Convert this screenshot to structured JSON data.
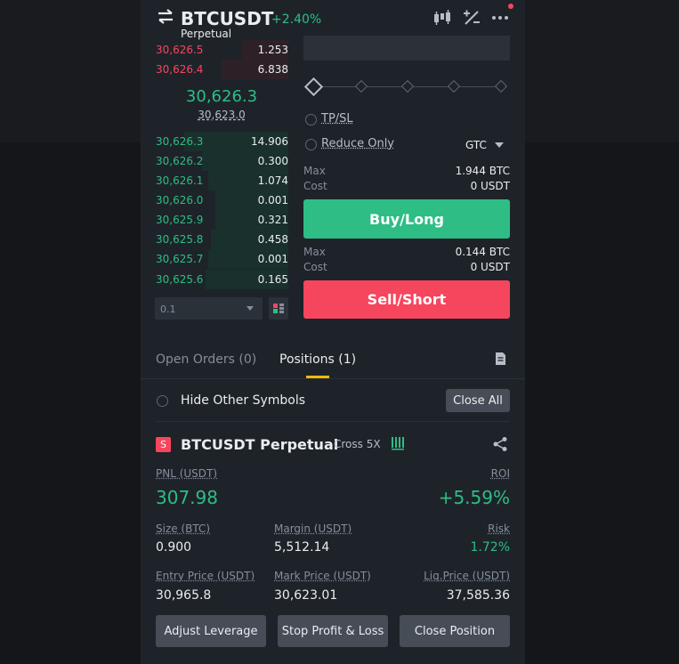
{
  "header": {
    "symbol": "BTCUSDT",
    "change": "+2.40%",
    "contract_type": "Perpetual",
    "icons": [
      "swap-icon",
      "candlestick-chart-icon",
      "percent-icon",
      "more-icon"
    ]
  },
  "order_book": {
    "asks": [
      {
        "price": "30,626.5",
        "qty": "1.253",
        "depth": 0.35
      },
      {
        "price": "30,626.4",
        "qty": "6.838",
        "depth": 0.5
      }
    ],
    "last_price": "30,626.3",
    "mark_price": "30,623.0",
    "bids": [
      {
        "price": "30,626.3",
        "qty": "14.906",
        "depth": 0.78
      },
      {
        "price": "30,626.2",
        "qty": "0.300",
        "depth": 0.65
      },
      {
        "price": "30,626.1",
        "qty": "1.074",
        "depth": 0.6
      },
      {
        "price": "30,626.0",
        "qty": "0.001",
        "depth": 0.55
      },
      {
        "price": "30,625.9",
        "qty": "0.321",
        "depth": 0.55
      },
      {
        "price": "30,625.8",
        "qty": "0.458",
        "depth": 0.58
      },
      {
        "price": "30,625.7",
        "qty": "0.001",
        "depth": 0.6
      },
      {
        "price": "30,625.6",
        "qty": "0.165",
        "depth": 0.62
      }
    ],
    "depth_precision": "0.1"
  },
  "order_form": {
    "tp_sl_label": "TP/SL",
    "reduce_only_label": "Reduce Only",
    "time_in_force": "GTC",
    "buy": {
      "max_label": "Max",
      "max_value": "1.944 BTC",
      "cost_label": "Cost",
      "cost_value": "0 USDT",
      "button": "Buy/Long"
    },
    "sell": {
      "max_label": "Max",
      "max_value": "0.144 BTC",
      "cost_label": "Cost",
      "cost_value": "0 USDT",
      "button": "Sell/Short"
    }
  },
  "tabs": {
    "open_orders": "Open Orders (0)",
    "positions": "Positions (1)"
  },
  "positions_panel": {
    "hide_other_label": "Hide Other Symbols",
    "close_all": "Close All"
  },
  "position": {
    "side_badge": "S",
    "title": "BTCUSDT Perpetual",
    "margin_mode": "Cross 5X",
    "pnl_label": "PNL (USDT)",
    "pnl_value": "307.98",
    "roi_label": "ROI",
    "roi_value": "+5.59%",
    "size_label": "Size (BTC)",
    "size_value": "0.900",
    "margin_label": "Margin (USDT)",
    "margin_value": "5,512.14",
    "risk_label": "Risk",
    "risk_value": "1.72%",
    "entry_label": "Entry Price (USDT)",
    "entry_value": "30,965.8",
    "mark_label": "Mark Price (USDT)",
    "mark_value": "30,623.01",
    "liq_label": "Liq.Price (USDT)",
    "liq_value": "37,585.36",
    "actions": [
      "Adjust Leverage",
      "Stop Profit & Loss",
      "Close Position"
    ]
  },
  "colors": {
    "green": "#2ebd85",
    "red": "#f6465d",
    "yellow": "#f0b90b",
    "panel": "#1e2329"
  }
}
